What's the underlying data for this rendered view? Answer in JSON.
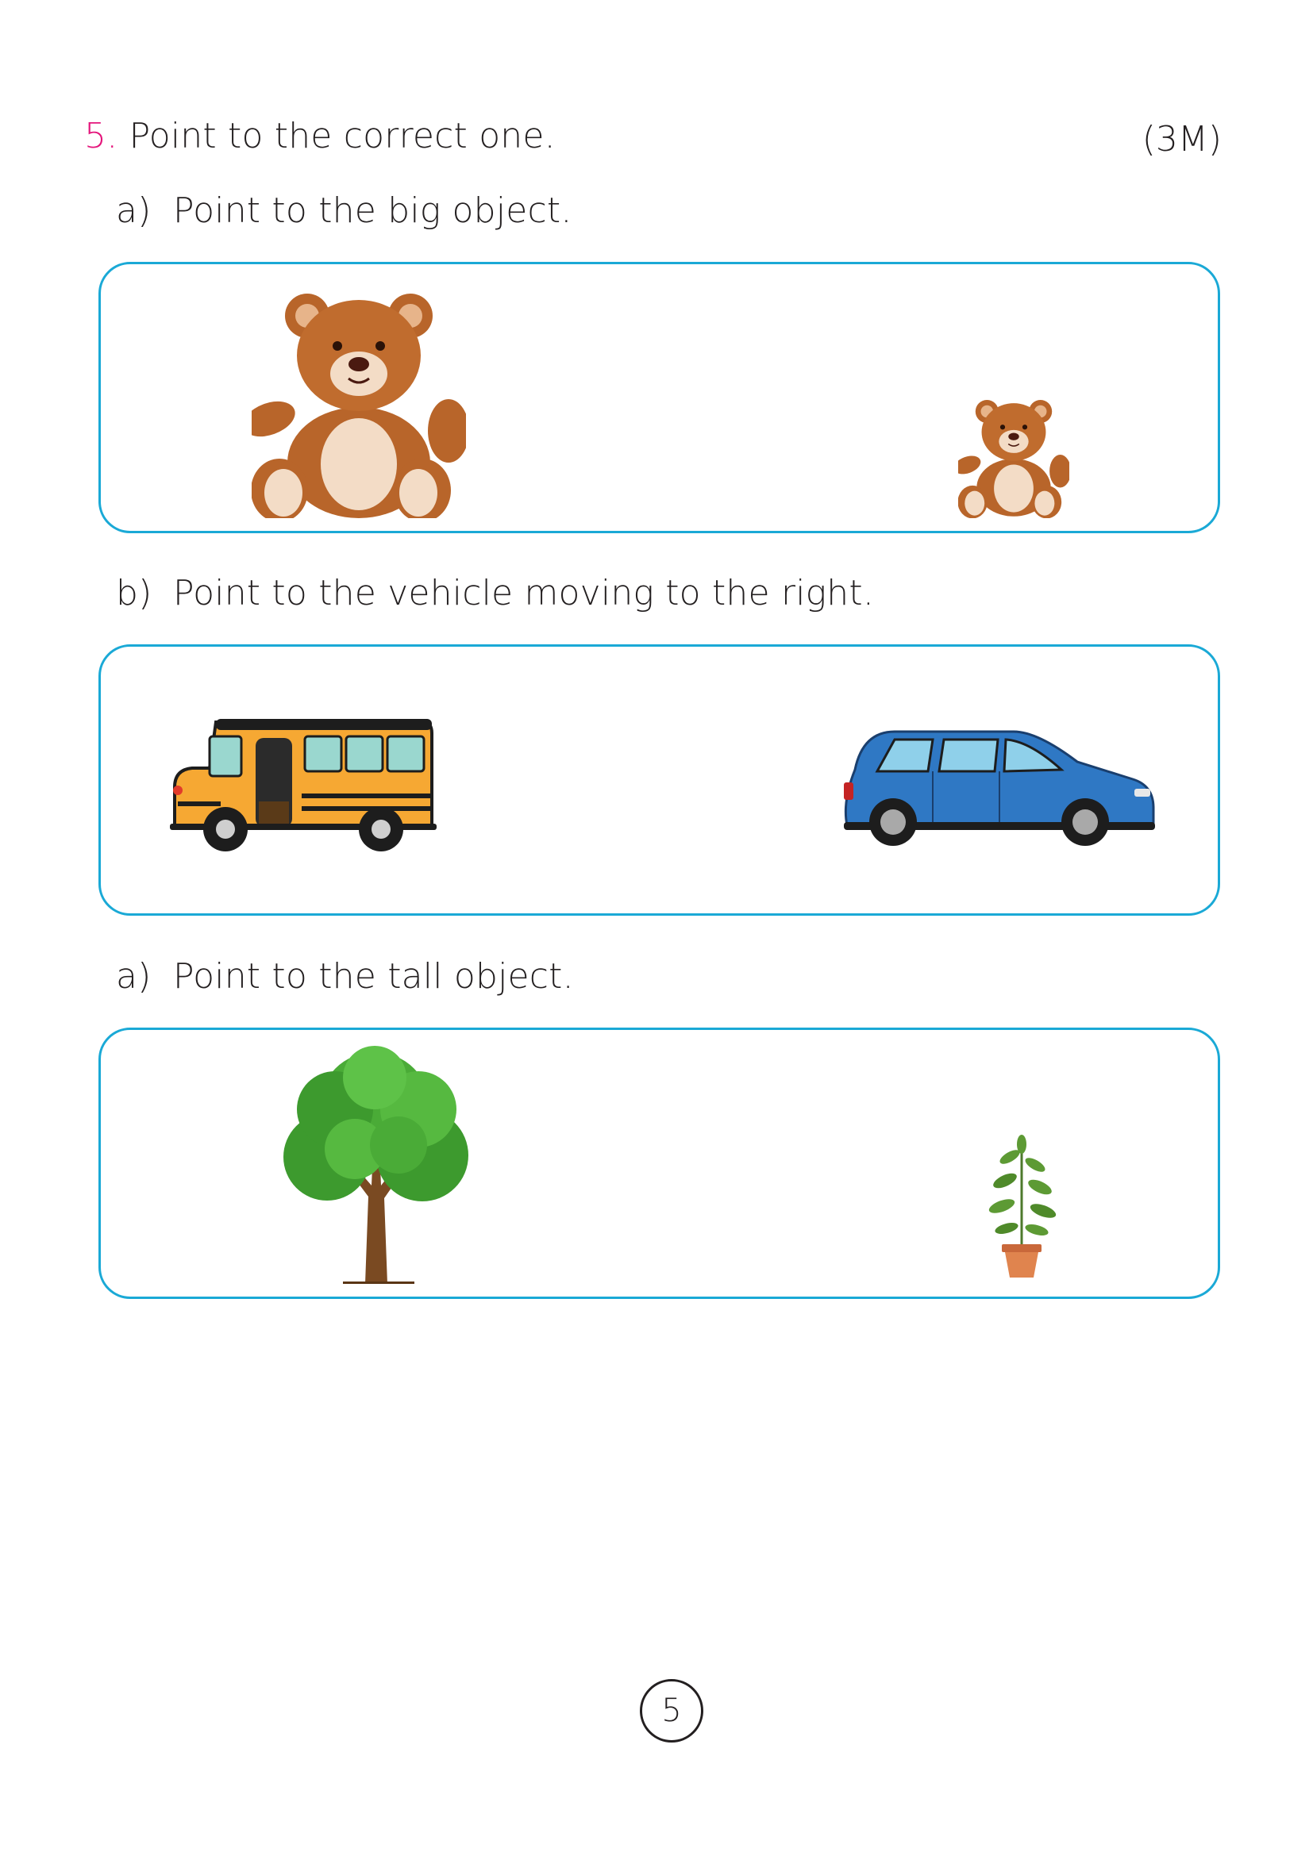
{
  "question": {
    "number": "5.",
    "text": "Point to the correct one.",
    "marks": "(3M)"
  },
  "parts": [
    {
      "label": "a)",
      "prompt": "Point to the big object.",
      "options": [
        {
          "name": "big-teddy-bear",
          "icon": "teddy-bear-icon"
        },
        {
          "name": "small-teddy-bear",
          "icon": "teddy-bear-icon"
        }
      ]
    },
    {
      "label": "b)",
      "prompt": "Point to the vehicle moving to the right.",
      "options": [
        {
          "name": "school-bus",
          "icon": "bus-icon"
        },
        {
          "name": "blue-car",
          "icon": "car-icon"
        }
      ]
    },
    {
      "label": "a)",
      "prompt": "Point to the tall object.",
      "options": [
        {
          "name": "tree",
          "icon": "tree-icon"
        },
        {
          "name": "potted-plant",
          "icon": "potted-plant-icon"
        }
      ]
    }
  ],
  "page_number": "5",
  "colors": {
    "accent_number": "#e4157b",
    "box_border": "#1aa9d6",
    "bear": "#b8652a",
    "bus": "#f6a833",
    "car": "#2f78c4",
    "tree": "#3d9a2e"
  }
}
